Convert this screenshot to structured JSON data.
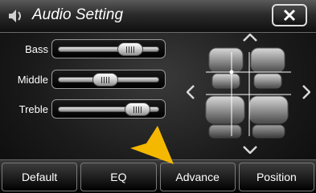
{
  "header": {
    "title": "Audio Setting",
    "icon": "speaker-icon",
    "close_icon": "close-icon"
  },
  "sliders": [
    {
      "label": "Bass",
      "value": 0.72
    },
    {
      "label": "Middle",
      "value": 0.47
    },
    {
      "label": "Treble",
      "value": 0.79
    }
  ],
  "balance": {
    "icons": [
      "arrow-up-icon",
      "arrow-down-icon",
      "arrow-left-icon",
      "arrow-right-icon"
    ]
  },
  "tabs": [
    {
      "label": "Default"
    },
    {
      "label": "EQ"
    },
    {
      "label": "Advance"
    },
    {
      "label": "Position"
    }
  ],
  "colors": {
    "pointer": "#f5b800",
    "text": "#ffffff"
  }
}
